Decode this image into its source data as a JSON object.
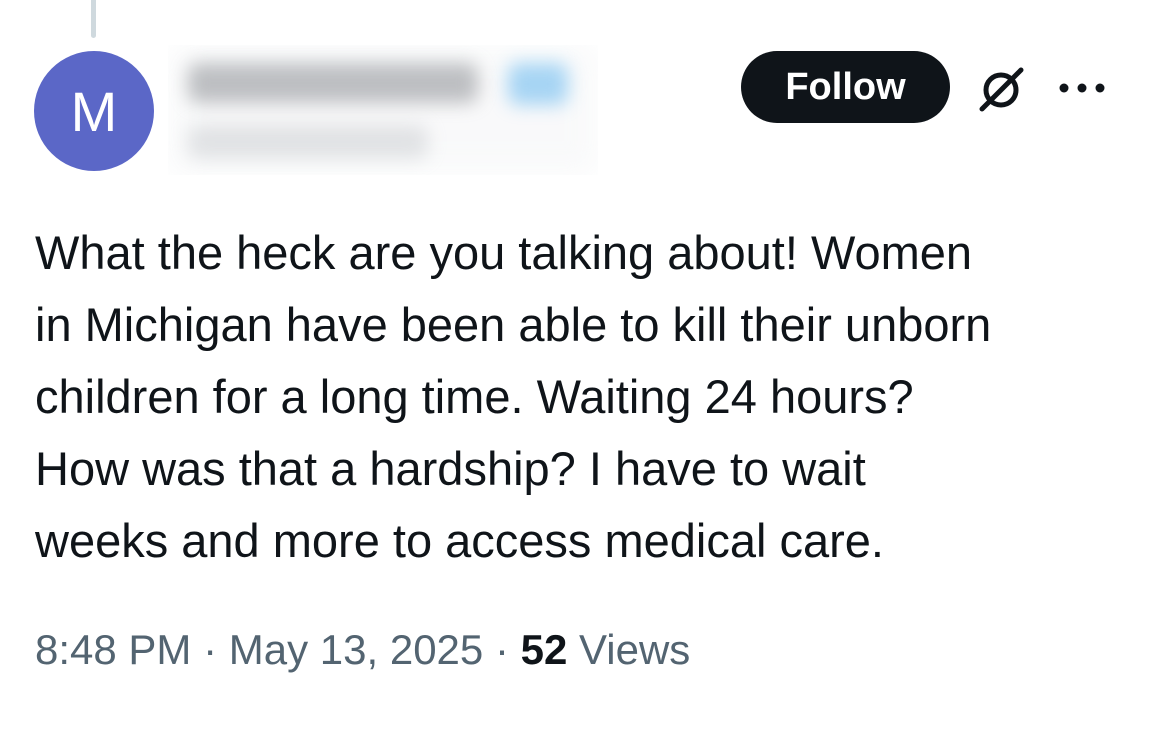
{
  "author": {
    "avatar_letter": "M",
    "avatar_color": "#5b67c7"
  },
  "actions": {
    "follow_label": "Follow",
    "grok_icon": "grok-icon",
    "more_icon": "more-options-icon"
  },
  "tweet": {
    "text": "What the heck are you talking about! Women\nin Michigan have been able to kill their unborn\nchildren for a long time. Waiting 24 hours?\nHow was that a hardship? I have to wait\nweeks and more to access medical care.",
    "time": "8:48 PM",
    "date": "May 13, 2025",
    "separator": "·",
    "views_count": "52",
    "views_label": "Views"
  },
  "colors": {
    "text": "#0f1419",
    "secondary_text": "#536471",
    "button_bg": "#0f1419",
    "thread_line": "#cfd9de"
  }
}
